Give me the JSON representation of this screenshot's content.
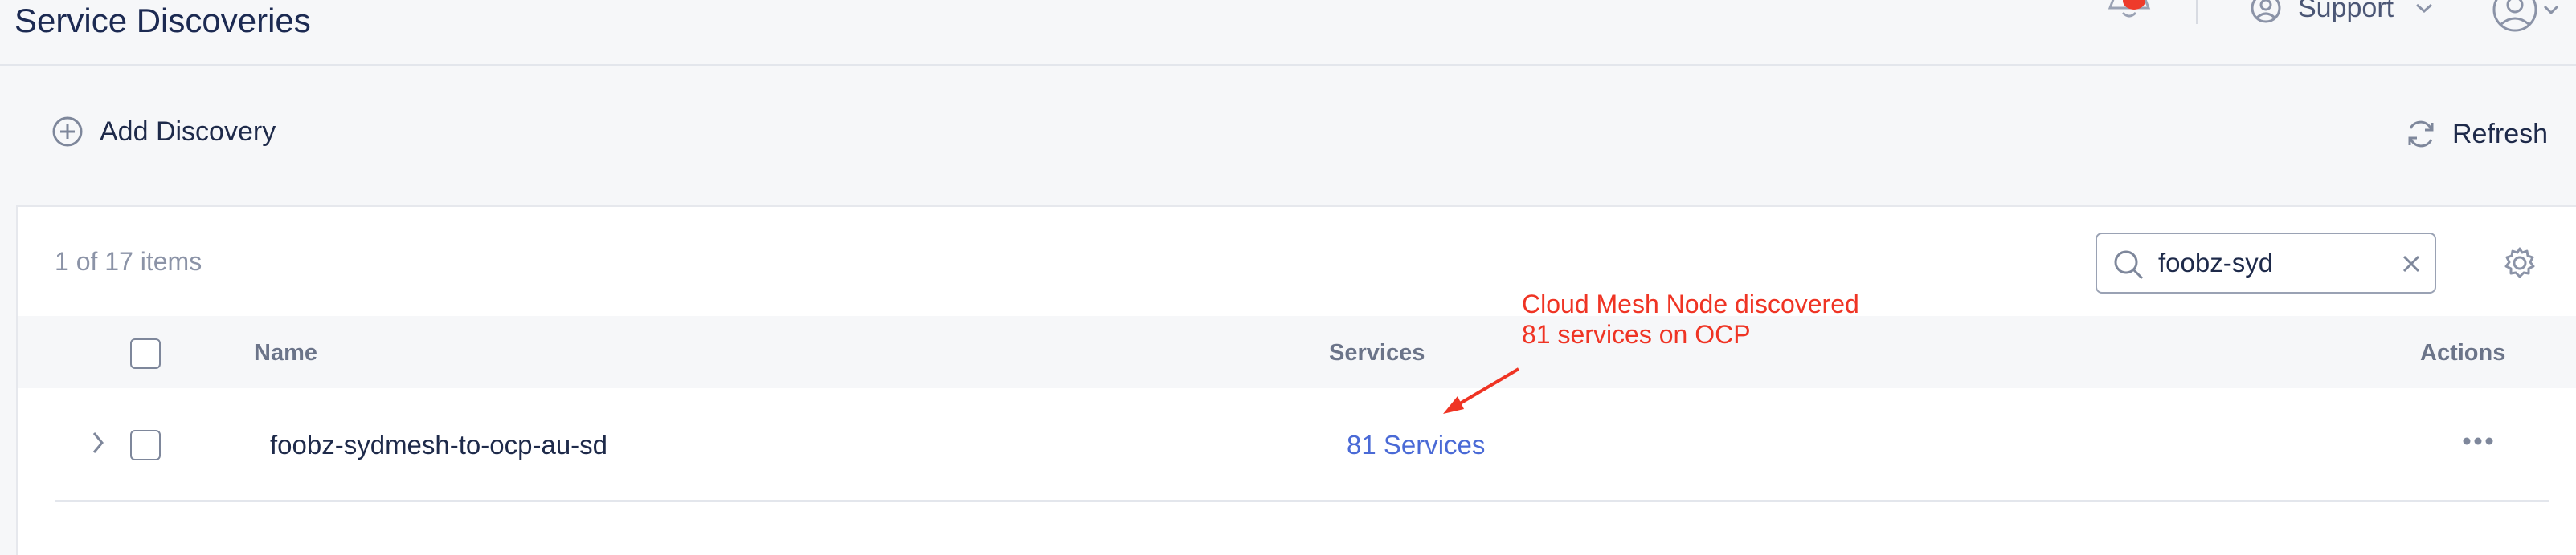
{
  "header": {
    "title": "Service Discoveries",
    "support_label": "Support",
    "badge_color": "#ee3b2b"
  },
  "toolbar": {
    "add_label": "Add Discovery",
    "refresh_label": "Refresh"
  },
  "table": {
    "count_text": "1 of 17 items",
    "search_value": "foobz-syd",
    "columns": {
      "name": "Name",
      "services": "Services",
      "actions": "Actions"
    },
    "rows": [
      {
        "name": "foobz-sydmesh-to-ocp-au-sd",
        "services": "81 Services"
      }
    ]
  },
  "annotation": {
    "text": "Cloud Mesh Node discovered 81 services on OCP",
    "color": "#ef3424"
  },
  "icons": {
    "bell": "bell-icon",
    "support": "support-icon",
    "user": "user-icon",
    "add": "plus-circle-icon",
    "refresh": "refresh-icon",
    "search": "search-icon",
    "clear": "close-icon",
    "settings": "gear-icon",
    "expand": "chevron-right-icon",
    "actions": "more-horizontal-icon"
  }
}
